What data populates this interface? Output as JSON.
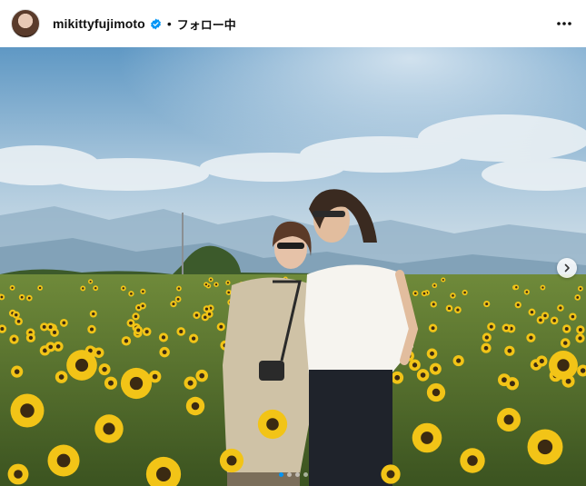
{
  "header": {
    "username": "mikittyfujimoto",
    "separator": "•",
    "follow_status": "フォロー中",
    "verified_icon": "verified-badge-icon",
    "more_icon": "more-horizontal-icon",
    "avatar_icon": "profile-avatar"
  },
  "post": {
    "carousel_total": 4,
    "carousel_index": 1,
    "next_icon": "chevron-right-icon"
  },
  "colors": {
    "accent": "#0095f6",
    "sky_top": "#6fa3c9",
    "sky_bottom": "#c9dbe6",
    "field_green": "#4f6b2a",
    "sunflower": "#f2c417"
  }
}
